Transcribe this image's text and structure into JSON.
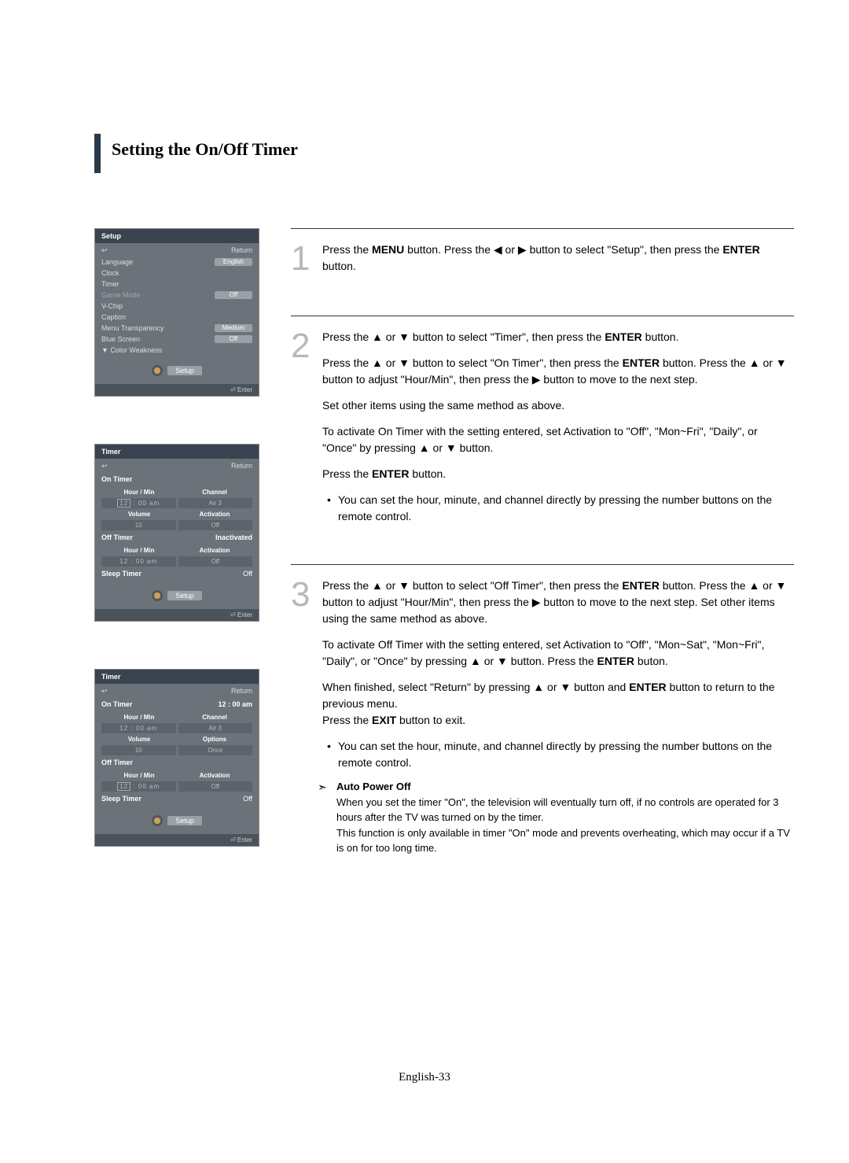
{
  "page": {
    "title": "Setting the On/Off Timer",
    "footer": "English-33"
  },
  "osd1": {
    "title": "Setup",
    "return": "Return",
    "rows": {
      "language_label": "Language",
      "language_value": "English",
      "clock_label": "Clock",
      "timer_label": "Timer",
      "gamemode_label": "Game Mode",
      "gamemode_value": "Off",
      "vchip_label": "V-Chip",
      "caption_label": "Caption",
      "transparency_label": "Menu Transparency",
      "transparency_value": "Medium",
      "bluescreen_label": "Blue Screen",
      "bluescreen_value": "Off",
      "colorweak_label": "▼ Color Weakness"
    },
    "footer_label": "Setup",
    "enter": "Enter"
  },
  "osd2": {
    "title": "Timer",
    "return": "Return",
    "ontimer_label": "On Timer",
    "hourmin_label": "Hour / Min",
    "channel_label": "Channel",
    "time_value": "12  :  00    am",
    "channel_value": "Air           3",
    "volume_label": "Volume",
    "activation_label": "Activation",
    "volume_value": "10",
    "activation_value": "Off",
    "offtimer_label": "Off Timer",
    "offtimer_value": "Inactivated",
    "hourmin2_label": "Hour / Min",
    "activation2_label": "Activation",
    "time2_value": "12   :  00    am",
    "activation2_value": "Off",
    "sleeptimer_label": "Sleep Timer",
    "sleeptimer_value": "Off",
    "footer_label": "Setup",
    "enter": "Enter"
  },
  "osd3": {
    "title": "Timer",
    "return": "Return",
    "ontimer_label": "On Timer",
    "ontimer_value": "12 : 00 am",
    "hourmin_label": "Hour / Min",
    "channel_label": "Channel",
    "time_value": "12   :  00    am",
    "channel_value": "Air           3",
    "volume_label": "Volume",
    "options_label": "Options",
    "volume_value": "10",
    "options_value": "Once",
    "offtimer_label": "Off Timer",
    "hourmin2_label": "Hour / Min",
    "activation2_label": "Activation",
    "time2_value": "12  :  00    am",
    "activation2_value": "Off",
    "sleeptimer_label": "Sleep Timer",
    "sleeptimer_value": "Off",
    "footer_label": "Setup",
    "enter": "Enter"
  },
  "steps": {
    "1": {
      "num": "1",
      "text": "Press the <b>MENU</b> button. Press the <span class='arrow'>◀</span> or <span class='arrow'>▶</span>  button to select \"Setup\", then press the <b>ENTER</b> button."
    },
    "2": {
      "num": "2",
      "line1": "Press the <span class='arrow'>▲</span> or <span class='arrow'>▼</span> button to select \"Timer\", then press the <b>ENTER</b> button.",
      "line2": "Press the <span class='arrow'>▲</span> or <span class='arrow'>▼</span> button to select \"On Timer\", then press the <b>ENTER</b> button. Press the <span class='arrow'>▲</span> or <span class='arrow'>▼</span> button to adjust \"Hour/Min\", then press the <span class='arrow'>▶</span> button to move to the next step.",
      "line3": "Set other items using the same method as above.",
      "line4": "To activate On Timer with the setting entered, set Activation to \"Off\", \"Mon~Fri\", \"Daily\", or \"Once\" by pressing <span class='arrow'>▲</span> or <span class='arrow'>▼</span> button.",
      "line5": "Press the <b>ENTER</b> button.",
      "bullet": "You can set the hour, minute, and channel directly by pressing the number buttons on the remote control."
    },
    "3": {
      "num": "3",
      "line1": "Press the <span class='arrow'>▲</span> or <span class='arrow'>▼</span> button to select \"Off Timer\", then press the <b>ENTER</b> button. Press the <span class='arrow'>▲</span> or <span class='arrow'>▼</span> button to adjust \"Hour/Min\", then press the <span class='arrow'>▶</span> button to move to the next step. Set other items using the same method as above.",
      "line2": "To activate Off Timer with the setting entered, set Activation to \"Off\", \"Mon~Sat\", \"Mon~Fri\", \"Daily\", or \"Once\"  by pressing <span class='arrow'>▲</span> or <span class='arrow'>▼</span> button. Press the <b>ENTER</b> buton.",
      "line3": "When finished, select \"Return\" by pressing <span class='arrow'>▲</span> or <span class='arrow'>▼</span> button and <b>ENTER</b> button to return to the previous menu.<br>Press the <b>EXIT</b> button to exit.",
      "bullet": "You can set the hour, minute, and channel directly by pressing the number buttons on the remote control."
    }
  },
  "note": {
    "title": "Auto Power Off",
    "line1": "When you set the timer \"On\", the television will eventually turn off, if no controls are operated for 3 hours after the TV was turned on by the timer.",
    "line2": "This function is only available in timer \"On\" mode and prevents overheating, which may occur if a TV is on for too long time."
  }
}
